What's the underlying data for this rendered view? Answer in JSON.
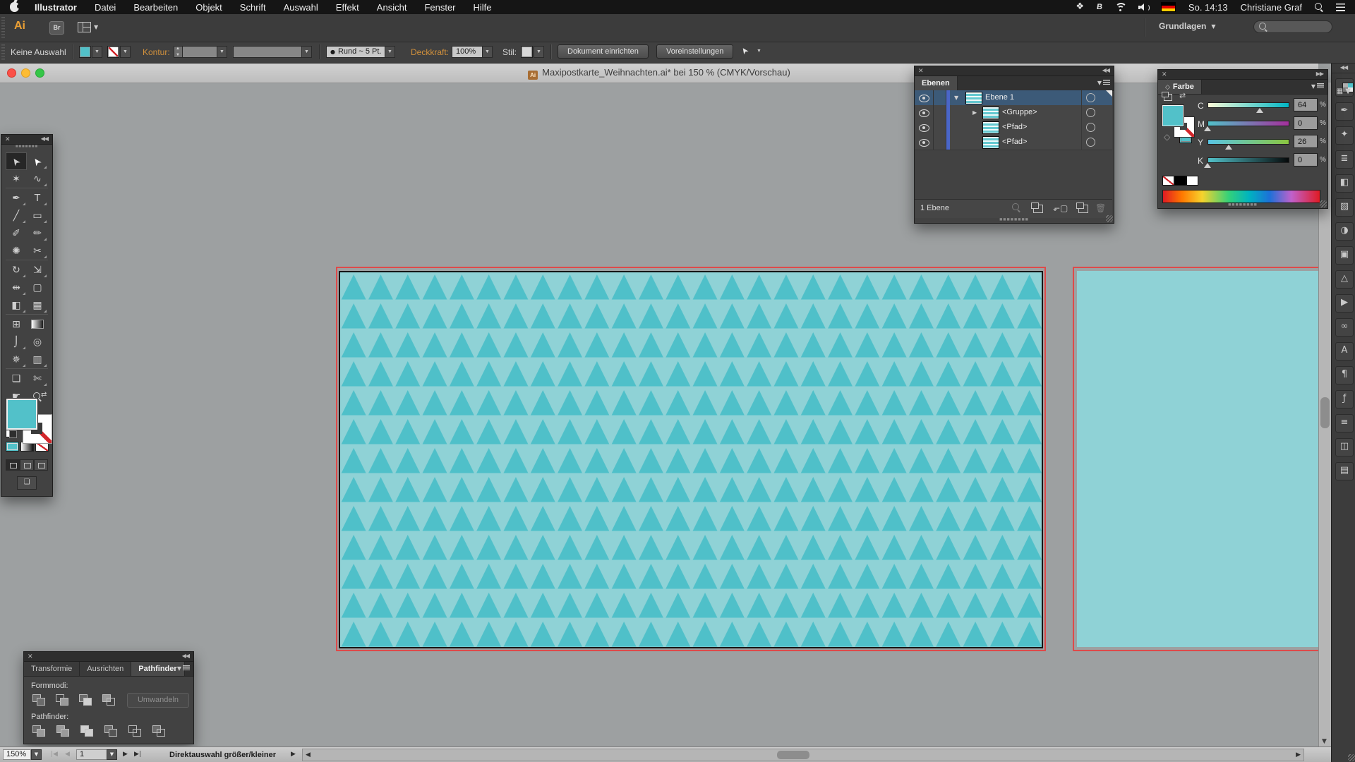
{
  "menu_bar": {
    "items": [
      "Illustrator",
      "Datei",
      "Bearbeiten",
      "Objekt",
      "Schrift",
      "Auswahl",
      "Effekt",
      "Ansicht",
      "Fenster",
      "Hilfe"
    ],
    "clock": "So. 14:13",
    "user": "Christiane Graf"
  },
  "app_bar": {
    "br_label": "Br",
    "workspace": "Grundlagen"
  },
  "control_bar": {
    "selection_status": "Keine Auswahl",
    "stroke_label": "Kontur:",
    "brush_bullet": "●",
    "brush_name": "Rund ~ 5 Pt.",
    "opacity_label": "Deckkraft:",
    "opacity_value": "100%",
    "style_label": "Stil:",
    "document_setup": "Dokument einrichten",
    "preferences": "Voreinstellungen"
  },
  "window": {
    "title": "Maxipostkarte_Weihnachten.ai* bei 150 % (CMYK/Vorschau)",
    "file_badge": "Ai"
  },
  "layers_panel": {
    "tab": "Ebenen",
    "rows": [
      {
        "name": "Ebene 1"
      },
      {
        "name": "<Gruppe>"
      },
      {
        "name": "<Pfad>"
      },
      {
        "name": "<Pfad>"
      }
    ],
    "footer": "1 Ebene"
  },
  "color_panel": {
    "tab": "Farbe",
    "sliders": [
      {
        "label": "C",
        "value": "64"
      },
      {
        "label": "M",
        "value": "0"
      },
      {
        "label": "Y",
        "value": "26"
      },
      {
        "label": "K",
        "value": "0"
      }
    ],
    "unit": "%"
  },
  "pathfinder_panel": {
    "tabs": [
      "Transformie",
      "Ausrichten",
      "Pathfinder"
    ],
    "form_modes_label": "Formmodi:",
    "pathfinder_label": "Pathfinder:",
    "convert_button": "Umwandeln"
  },
  "status_bar": {
    "zoom": "150%",
    "artboard_number": "1",
    "tool_status": "Direktauswahl größer/kleiner"
  },
  "artwork": {
    "fill_color": "#52c1c9",
    "artboard_bg": "#8fd2d6",
    "triangle_color": "#4fc0c9",
    "guide_color": "#de4a4a",
    "layer_color": "#4a66c8"
  },
  "toolbar": {
    "tools": [
      {
        "name": "selection-tool",
        "glyph": "➤"
      },
      {
        "name": "direct-selection-tool",
        "glyph": "➤"
      },
      {
        "name": "magic-wand-tool",
        "glyph": "✶"
      },
      {
        "name": "lasso-tool",
        "glyph": "∿"
      },
      {
        "name": "pen-tool",
        "glyph": "✒"
      },
      {
        "name": "type-tool",
        "glyph": "T"
      },
      {
        "name": "line-segment-tool",
        "glyph": "╱"
      },
      {
        "name": "rectangle-tool",
        "glyph": "▭"
      },
      {
        "name": "paintbrush-tool",
        "glyph": "✐"
      },
      {
        "name": "pencil-tool",
        "glyph": "✏"
      },
      {
        "name": "blob-brush-tool",
        "glyph": "✺"
      },
      {
        "name": "scissors-tool",
        "glyph": "✂"
      },
      {
        "name": "rotate-tool",
        "glyph": "↻"
      },
      {
        "name": "scale-tool",
        "glyph": "⇲"
      },
      {
        "name": "width-tool",
        "glyph": "⇹"
      },
      {
        "name": "free-transform-tool",
        "glyph": "▢"
      },
      {
        "name": "shape-builder-tool",
        "glyph": "◧"
      },
      {
        "name": "perspective-grid-tool",
        "glyph": "▦"
      },
      {
        "name": "mesh-tool",
        "glyph": "⊞"
      },
      {
        "name": "gradient-tool",
        "glyph": ""
      },
      {
        "name": "eyedropper-tool",
        "glyph": "⌡"
      },
      {
        "name": "blend-tool",
        "glyph": "◎"
      },
      {
        "name": "symbol-sprayer-tool",
        "glyph": "✵"
      },
      {
        "name": "column-graph-tool",
        "glyph": "▥"
      },
      {
        "name": "artboard-tool",
        "glyph": "❏"
      },
      {
        "name": "slice-tool",
        "glyph": "✄"
      },
      {
        "name": "hand-tool",
        "glyph": "☛"
      },
      {
        "name": "zoom-tool",
        "glyph": ""
      }
    ]
  },
  "dock": {
    "items": [
      {
        "name": "swatches-panel-icon",
        "glyph": ""
      },
      {
        "name": "brushes-panel-icon",
        "glyph": "✒"
      },
      {
        "name": "symbols-panel-icon",
        "glyph": "✦"
      },
      {
        "name": "stroke-panel-icon",
        "glyph": "≣"
      },
      {
        "name": "gradient-panel-icon",
        "glyph": "◧"
      },
      {
        "name": "transparency-panel-icon",
        "glyph": "▧"
      },
      {
        "name": "appearance-panel-icon",
        "glyph": "◑"
      },
      {
        "name": "graphic-styles-panel-icon",
        "glyph": "▣"
      },
      {
        "name": "color-guide-panel-icon",
        "glyph": "△"
      },
      {
        "name": "actions-panel-icon",
        "glyph": "▶"
      },
      {
        "name": "links-panel-icon",
        "glyph": "∞"
      },
      {
        "name": "character-panel-icon",
        "glyph": "A"
      },
      {
        "name": "paragraph-panel-icon",
        "glyph": "¶"
      },
      {
        "name": "opentype-panel-icon",
        "glyph": "ƒ"
      },
      {
        "name": "align-panel-icon",
        "glyph": "≡"
      },
      {
        "name": "pathfinder-panel-icon",
        "glyph": "◫"
      },
      {
        "name": "artboards-panel-icon",
        "glyph": "▤"
      }
    ]
  }
}
